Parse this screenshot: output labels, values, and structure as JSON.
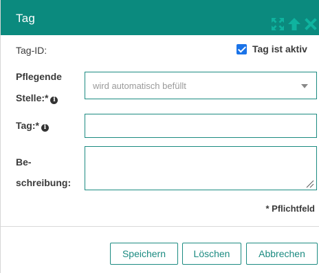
{
  "dialog": {
    "title": "Tag",
    "title_icons": [
      "expand-icon",
      "arrow-up-icon",
      "close-icon"
    ]
  },
  "fields": {
    "tag_id_label": "Tag-ID:",
    "active_label": "Tag ist aktiv",
    "active_checked": true,
    "stelle_label_line1": "Pflegende",
    "stelle_label_line2": "Stelle:*",
    "stelle_value": "wird automatisch befüllt",
    "tag_label": "Tag:*",
    "tag_value": "",
    "beschreibung_label_line1": "Be-",
    "beschreibung_label_line2": "schreibung:",
    "beschreibung_value": ""
  },
  "required_note": "* Pflichtfeld",
  "buttons": {
    "save": "Speichern",
    "delete": "Löschen",
    "cancel": "Abbrechen"
  },
  "colors": {
    "header": "#0b8a7e",
    "accent": "#1a8a80",
    "checkbox": "#1a73e8"
  }
}
